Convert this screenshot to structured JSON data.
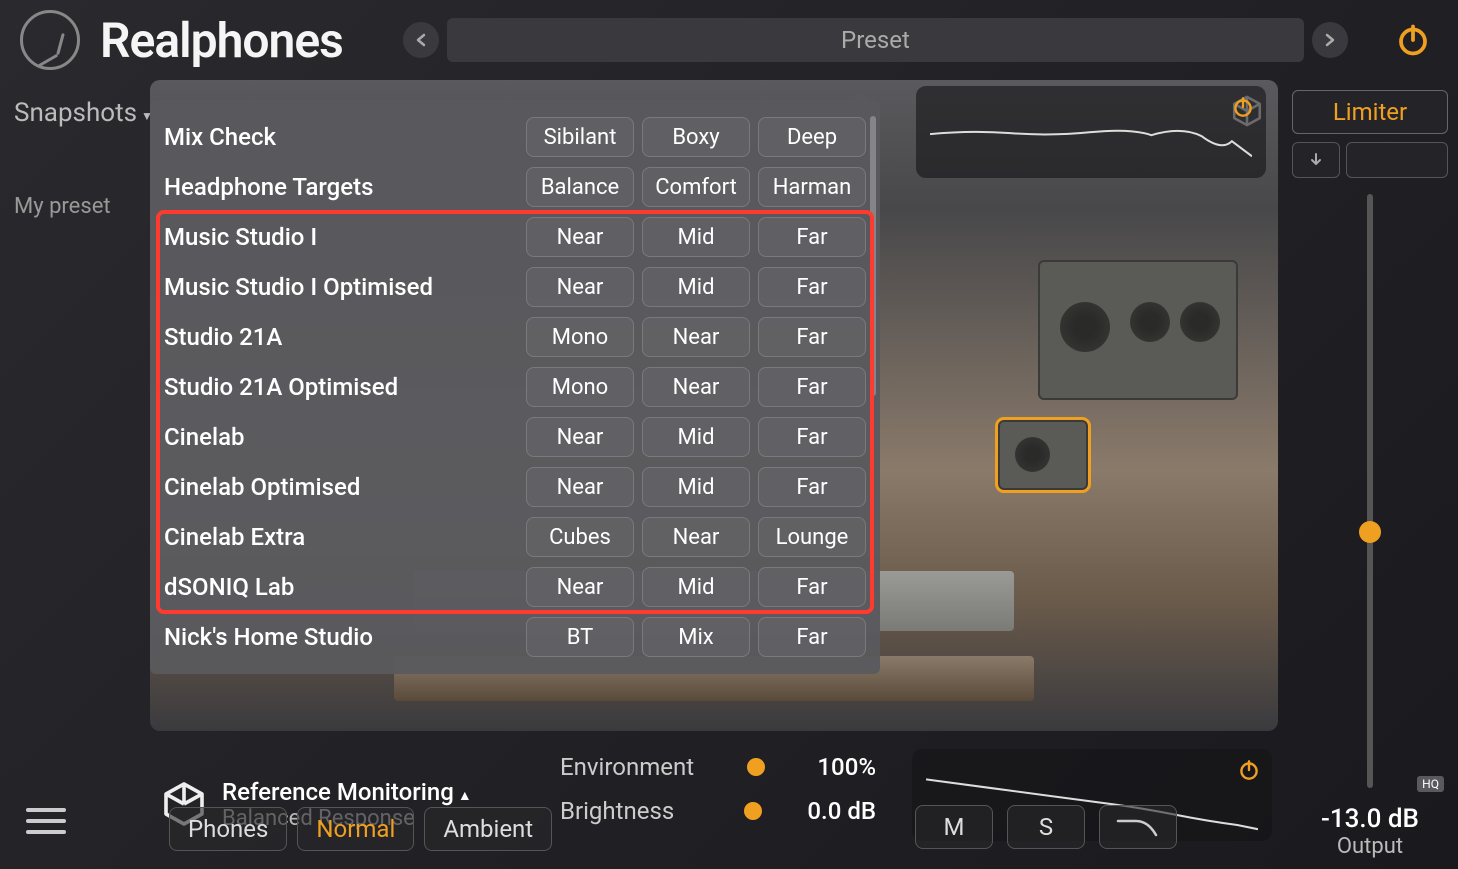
{
  "app": {
    "title": "Realphones"
  },
  "header": {
    "preset_label": "Preset"
  },
  "sidebar": {
    "snapshots_label": "Snapshots",
    "my_preset": "My preset"
  },
  "dropdown": {
    "rows": [
      {
        "label": "Mix Check",
        "opts": [
          "Sibilant",
          "Boxy",
          "Deep"
        ]
      },
      {
        "label": "Headphone Targets",
        "opts": [
          "Balance",
          "Comfort",
          "Harman"
        ]
      },
      {
        "label": "Music Studio I",
        "opts": [
          "Near",
          "Mid",
          "Far"
        ]
      },
      {
        "label": "Music Studio I Optimised",
        "opts": [
          "Near",
          "Mid",
          "Far"
        ]
      },
      {
        "label": "Studio 21A",
        "opts": [
          "Mono",
          "Near",
          "Far"
        ]
      },
      {
        "label": "Studio 21A Optimised",
        "opts": [
          "Mono",
          "Near",
          "Far"
        ]
      },
      {
        "label": "Cinelab",
        "opts": [
          "Near",
          "Mid",
          "Far"
        ]
      },
      {
        "label": "Cinelab Optimised",
        "opts": [
          "Near",
          "Mid",
          "Far"
        ]
      },
      {
        "label": "Cinelab Extra",
        "opts": [
          "Cubes",
          "Near",
          "Lounge"
        ]
      },
      {
        "label": "dSONIQ Lab",
        "opts": [
          "Near",
          "Mid",
          "Far"
        ]
      },
      {
        "label": "Nick's Home Studio",
        "opts": [
          "BT",
          "Mix",
          "Far"
        ]
      }
    ],
    "highlight": {
      "from_row": 2,
      "to_row": 9
    }
  },
  "reference": {
    "title": "Reference Monitoring",
    "subtitle": "Balanced Response"
  },
  "modes": {
    "phones": "Phones",
    "normal": "Normal",
    "ambient": "Ambient",
    "active": "normal"
  },
  "env": {
    "environment_label": "Environment",
    "environment_value": "100%",
    "environment_pct": 100,
    "brightness_label": "Brightness",
    "brightness_value": "0.0 dB",
    "brightness_pct": 50
  },
  "msf": {
    "m": "M",
    "s": "S"
  },
  "right": {
    "limiter": "Limiter",
    "hq": "HQ",
    "output_db": "-13.0 dB",
    "output_label": "Output",
    "slider_pct": 55
  },
  "colors": {
    "accent": "#f0a020",
    "highlight": "#ff3b30"
  }
}
